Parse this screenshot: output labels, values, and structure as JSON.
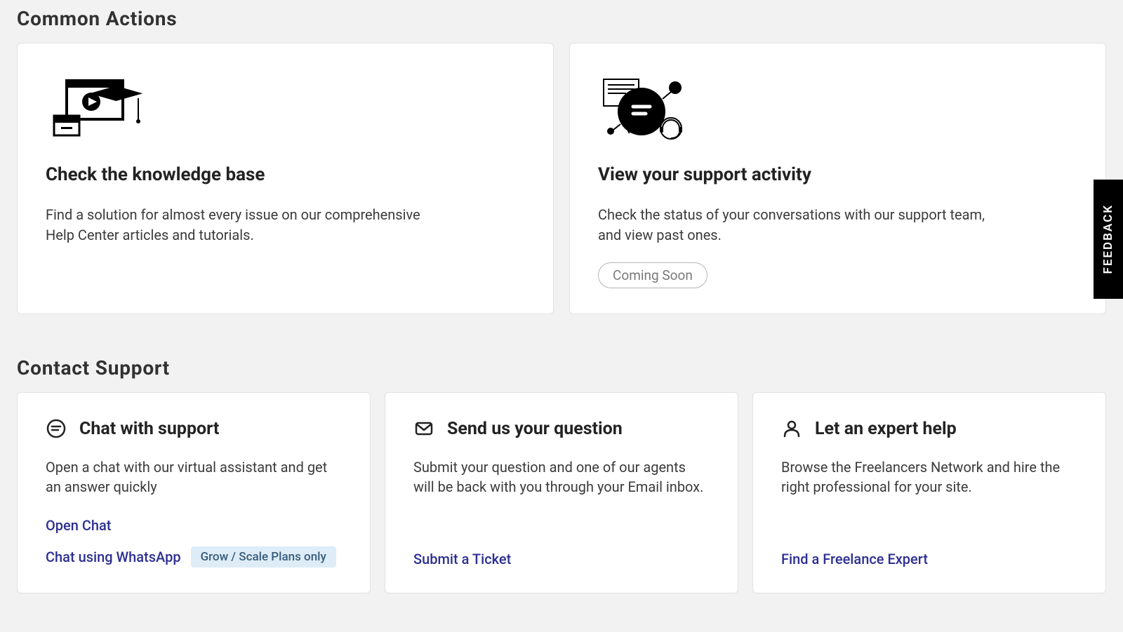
{
  "sections": {
    "common": {
      "title": "Common Actions",
      "cards": [
        {
          "title": "Check the knowledge base",
          "desc": "Find a solution for almost every issue on our comprehensive Help Center articles and tutorials."
        },
        {
          "title": "View your support activity",
          "desc": "Check the status of your conversations with our support team, and view past ones.",
          "pill": "Coming Soon"
        }
      ]
    },
    "contact": {
      "title": "Contact Support",
      "cards": [
        {
          "title": "Chat with support",
          "desc": "Open a chat with our virtual assistant and get an answer quickly",
          "links": [
            {
              "label": "Open Chat"
            },
            {
              "label": "Chat using WhatsApp",
              "badge": "Grow / Scale Plans only"
            }
          ]
        },
        {
          "title": "Send us your question",
          "desc": "Submit your question and one of our agents will be back with you through your Email inbox.",
          "links": [
            {
              "label": "Submit a Ticket"
            }
          ]
        },
        {
          "title": "Let an expert help",
          "desc": "Browse the Freelancers Network and hire the right professional for your site.",
          "links": [
            {
              "label": "Find a Freelance Expert"
            }
          ]
        }
      ]
    }
  },
  "feedback": {
    "label": "FEEDBACK"
  }
}
